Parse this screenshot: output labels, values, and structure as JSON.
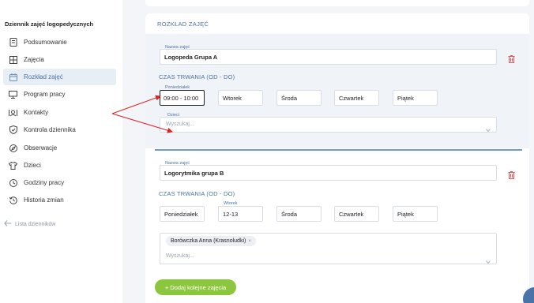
{
  "sidebar": {
    "title": "Dziennik zajęć logopedycznych",
    "items": [
      {
        "label": "Podsumowanie",
        "icon": "document-icon"
      },
      {
        "label": "Zajęcia",
        "icon": "grid-icon"
      },
      {
        "label": "Rozkład zajęć",
        "icon": "calendar-icon"
      },
      {
        "label": "Program pracy",
        "icon": "monitor-icon"
      },
      {
        "label": "Kontakty",
        "icon": "contacts-icon"
      },
      {
        "label": "Kontrola dziennika",
        "icon": "shield-icon"
      },
      {
        "label": "Obserwacje",
        "icon": "compass-icon"
      },
      {
        "label": "Dzieci",
        "icon": "shirt-icon"
      },
      {
        "label": "Godziny pracy",
        "icon": "clock-icon"
      },
      {
        "label": "Historia zmian",
        "icon": "history-icon"
      }
    ],
    "active_index": 2,
    "back_link": "Lista dzienników"
  },
  "schedule": {
    "section_title": "ROZKŁAD ZAJĘĆ",
    "blocks": [
      {
        "name_label": "Nazwa zajęć",
        "name_value": "Logopeda Grupa A",
        "duration_title": "CZAS TRWANIA (OD - DO)",
        "days": [
          {
            "label": "Poniedziałek",
            "value": "09:00 - 10:00"
          },
          {
            "label": "",
            "value": "Wtorek"
          },
          {
            "label": "",
            "value": "Środa"
          },
          {
            "label": "",
            "value": "Czwartek"
          },
          {
            "label": "",
            "value": "Piątek"
          }
        ],
        "children_label": "Dzieci",
        "children_placeholder": "Wyszukaj...",
        "children_chips": []
      },
      {
        "name_label": "Nazwa zajęć",
        "name_value": "Logorytmika grupa B",
        "duration_title": "CZAS TRWANIA (OD - DO)",
        "days": [
          {
            "label": "",
            "value": "Poniedziałek"
          },
          {
            "label": "Wtorek",
            "value": "12-13"
          },
          {
            "label": "",
            "value": "Środa"
          },
          {
            "label": "",
            "value": "Czwartek"
          },
          {
            "label": "",
            "value": "Piątek"
          }
        ],
        "children_label": "",
        "children_placeholder": "Wyszukaj...",
        "children_chips": [
          "Borówczka Anna (Krasnoludki)"
        ]
      }
    ],
    "add_button": "+ Dodaj kolejne zajęcia"
  },
  "colors": {
    "accent": "#4a73a8",
    "active_bg": "#e8eef6",
    "add_button": "#8cc63f",
    "delete": "#e05a5a",
    "annotation_arrow": "#e02020"
  }
}
